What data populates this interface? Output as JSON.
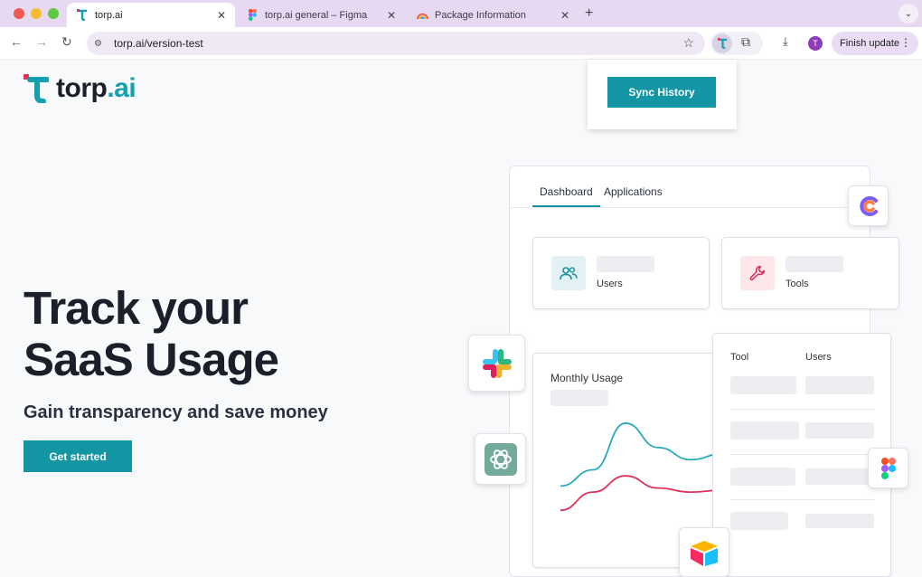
{
  "browser": {
    "tabs": [
      {
        "title": "torp.ai",
        "active": true
      },
      {
        "title": "torp.ai general – Figma",
        "active": false
      },
      {
        "title": "Package Information",
        "active": false
      }
    ],
    "address": "torp.ai/version-test",
    "avatar_initial": "T",
    "finish_update_label": "Finish update"
  },
  "page": {
    "logo": {
      "part1": "torp",
      "part2": ".ai"
    },
    "hero": {
      "line1": "Track your",
      "line2": "SaaS Usage",
      "subtitle": "Gain transparency and save money",
      "cta_label": "Get started"
    },
    "sync_button_label": "Sync History",
    "dashboard": {
      "tabs": [
        "Dashboard",
        "Applications"
      ],
      "active_tab": "Dashboard",
      "stats": [
        {
          "label": "Users",
          "icon": "users-icon"
        },
        {
          "label": "Tools",
          "icon": "wrench-icon"
        }
      ],
      "chart": {
        "title": "Monthly Usage"
      },
      "table": {
        "headers": [
          "Tool",
          "Users"
        ]
      }
    },
    "floating_icons": [
      "slack-icon",
      "openai-icon",
      "airtable-icon",
      "figma-icon",
      "clickup-icon"
    ]
  },
  "colors": {
    "brand_teal": "#1495a3",
    "chart_line_teal": "#2aa9bd",
    "chart_line_red": "#e0305c",
    "tabbar_lavender": "#e7d9f1"
  },
  "chart_data": {
    "type": "line",
    "title": "Monthly Usage",
    "series": [
      {
        "color": "#2aa9bd",
        "values": [
          0.3,
          0.46,
          0.92,
          0.68,
          0.56,
          0.62
        ]
      },
      {
        "color": "#e0305c",
        "values": [
          0.06,
          0.24,
          0.4,
          0.28,
          0.24,
          0.26
        ]
      }
    ]
  }
}
